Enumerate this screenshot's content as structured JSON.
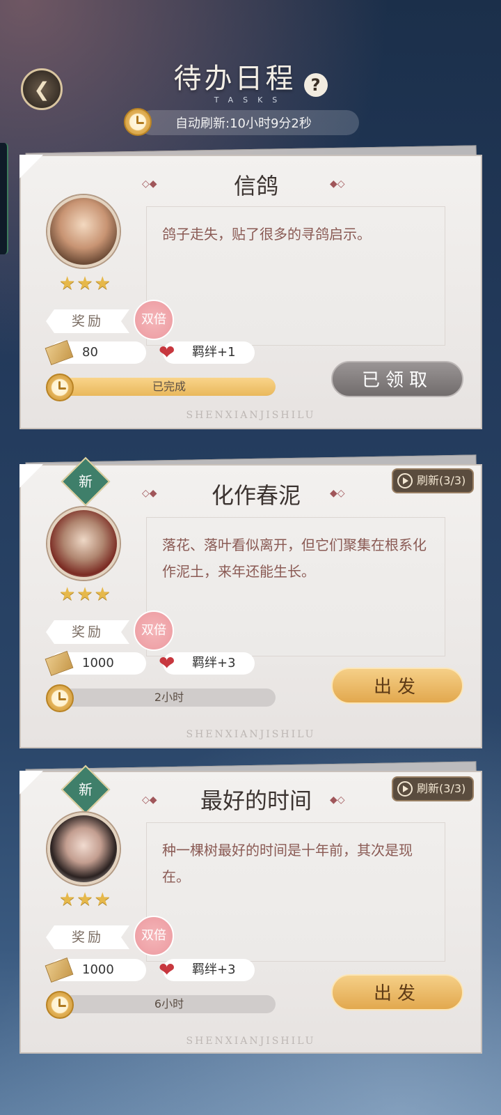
{
  "header": {
    "title": "待办日程",
    "subtitle": "TASKS",
    "refresh_label": "自动刷新:10小时9分2秒"
  },
  "cards": [
    {
      "title": "信鸽",
      "description": "鸽子走失，贴了很多的寻鸽启示。",
      "stars": "★★★",
      "reward_label": "奖励",
      "double_label": "双倍",
      "coin": "80",
      "bond": "羁绊+1",
      "progress_text": "已完成",
      "progress_fraction": 1.0,
      "button_label": "已领取",
      "watermark": "SHENXIANJISHILU"
    },
    {
      "new_label": "新",
      "refresh_chip": "刷新(3/3)",
      "title": "化作春泥",
      "description": "落花、落叶看似离开，但它们聚集在根系化作泥土，来年还能生长。",
      "stars": "★★★",
      "reward_label": "奖励",
      "double_label": "双倍",
      "coin": "1000",
      "bond": "羁绊+3",
      "progress_text": "2小时",
      "progress_fraction": 0.0,
      "button_label": "出发",
      "watermark": "SHENXIANJISHILU"
    },
    {
      "new_label": "新",
      "refresh_chip": "刷新(3/3)",
      "title": "最好的时间",
      "description": "种一棵树最好的时间是十年前，其次是现在。",
      "stars": "★★★",
      "reward_label": "奖励",
      "double_label": "双倍",
      "coin": "1000",
      "bond": "羁绊+3",
      "progress_text": "6小时",
      "progress_fraction": 0.0,
      "button_label": "出发",
      "watermark": "SHENXIANJISHILU"
    }
  ],
  "icons": {
    "back": "back-arrow-icon",
    "help": "question-icon",
    "clock": "stopwatch-icon",
    "ticket": "ticket-icon",
    "heart": "heart-icon",
    "play": "play-icon"
  },
  "colors": {
    "gold_button": "#e2a84e",
    "gray_button": "#716c6c",
    "double_badge": "#ec9aa0",
    "new_badge": "#3f7f6a"
  }
}
